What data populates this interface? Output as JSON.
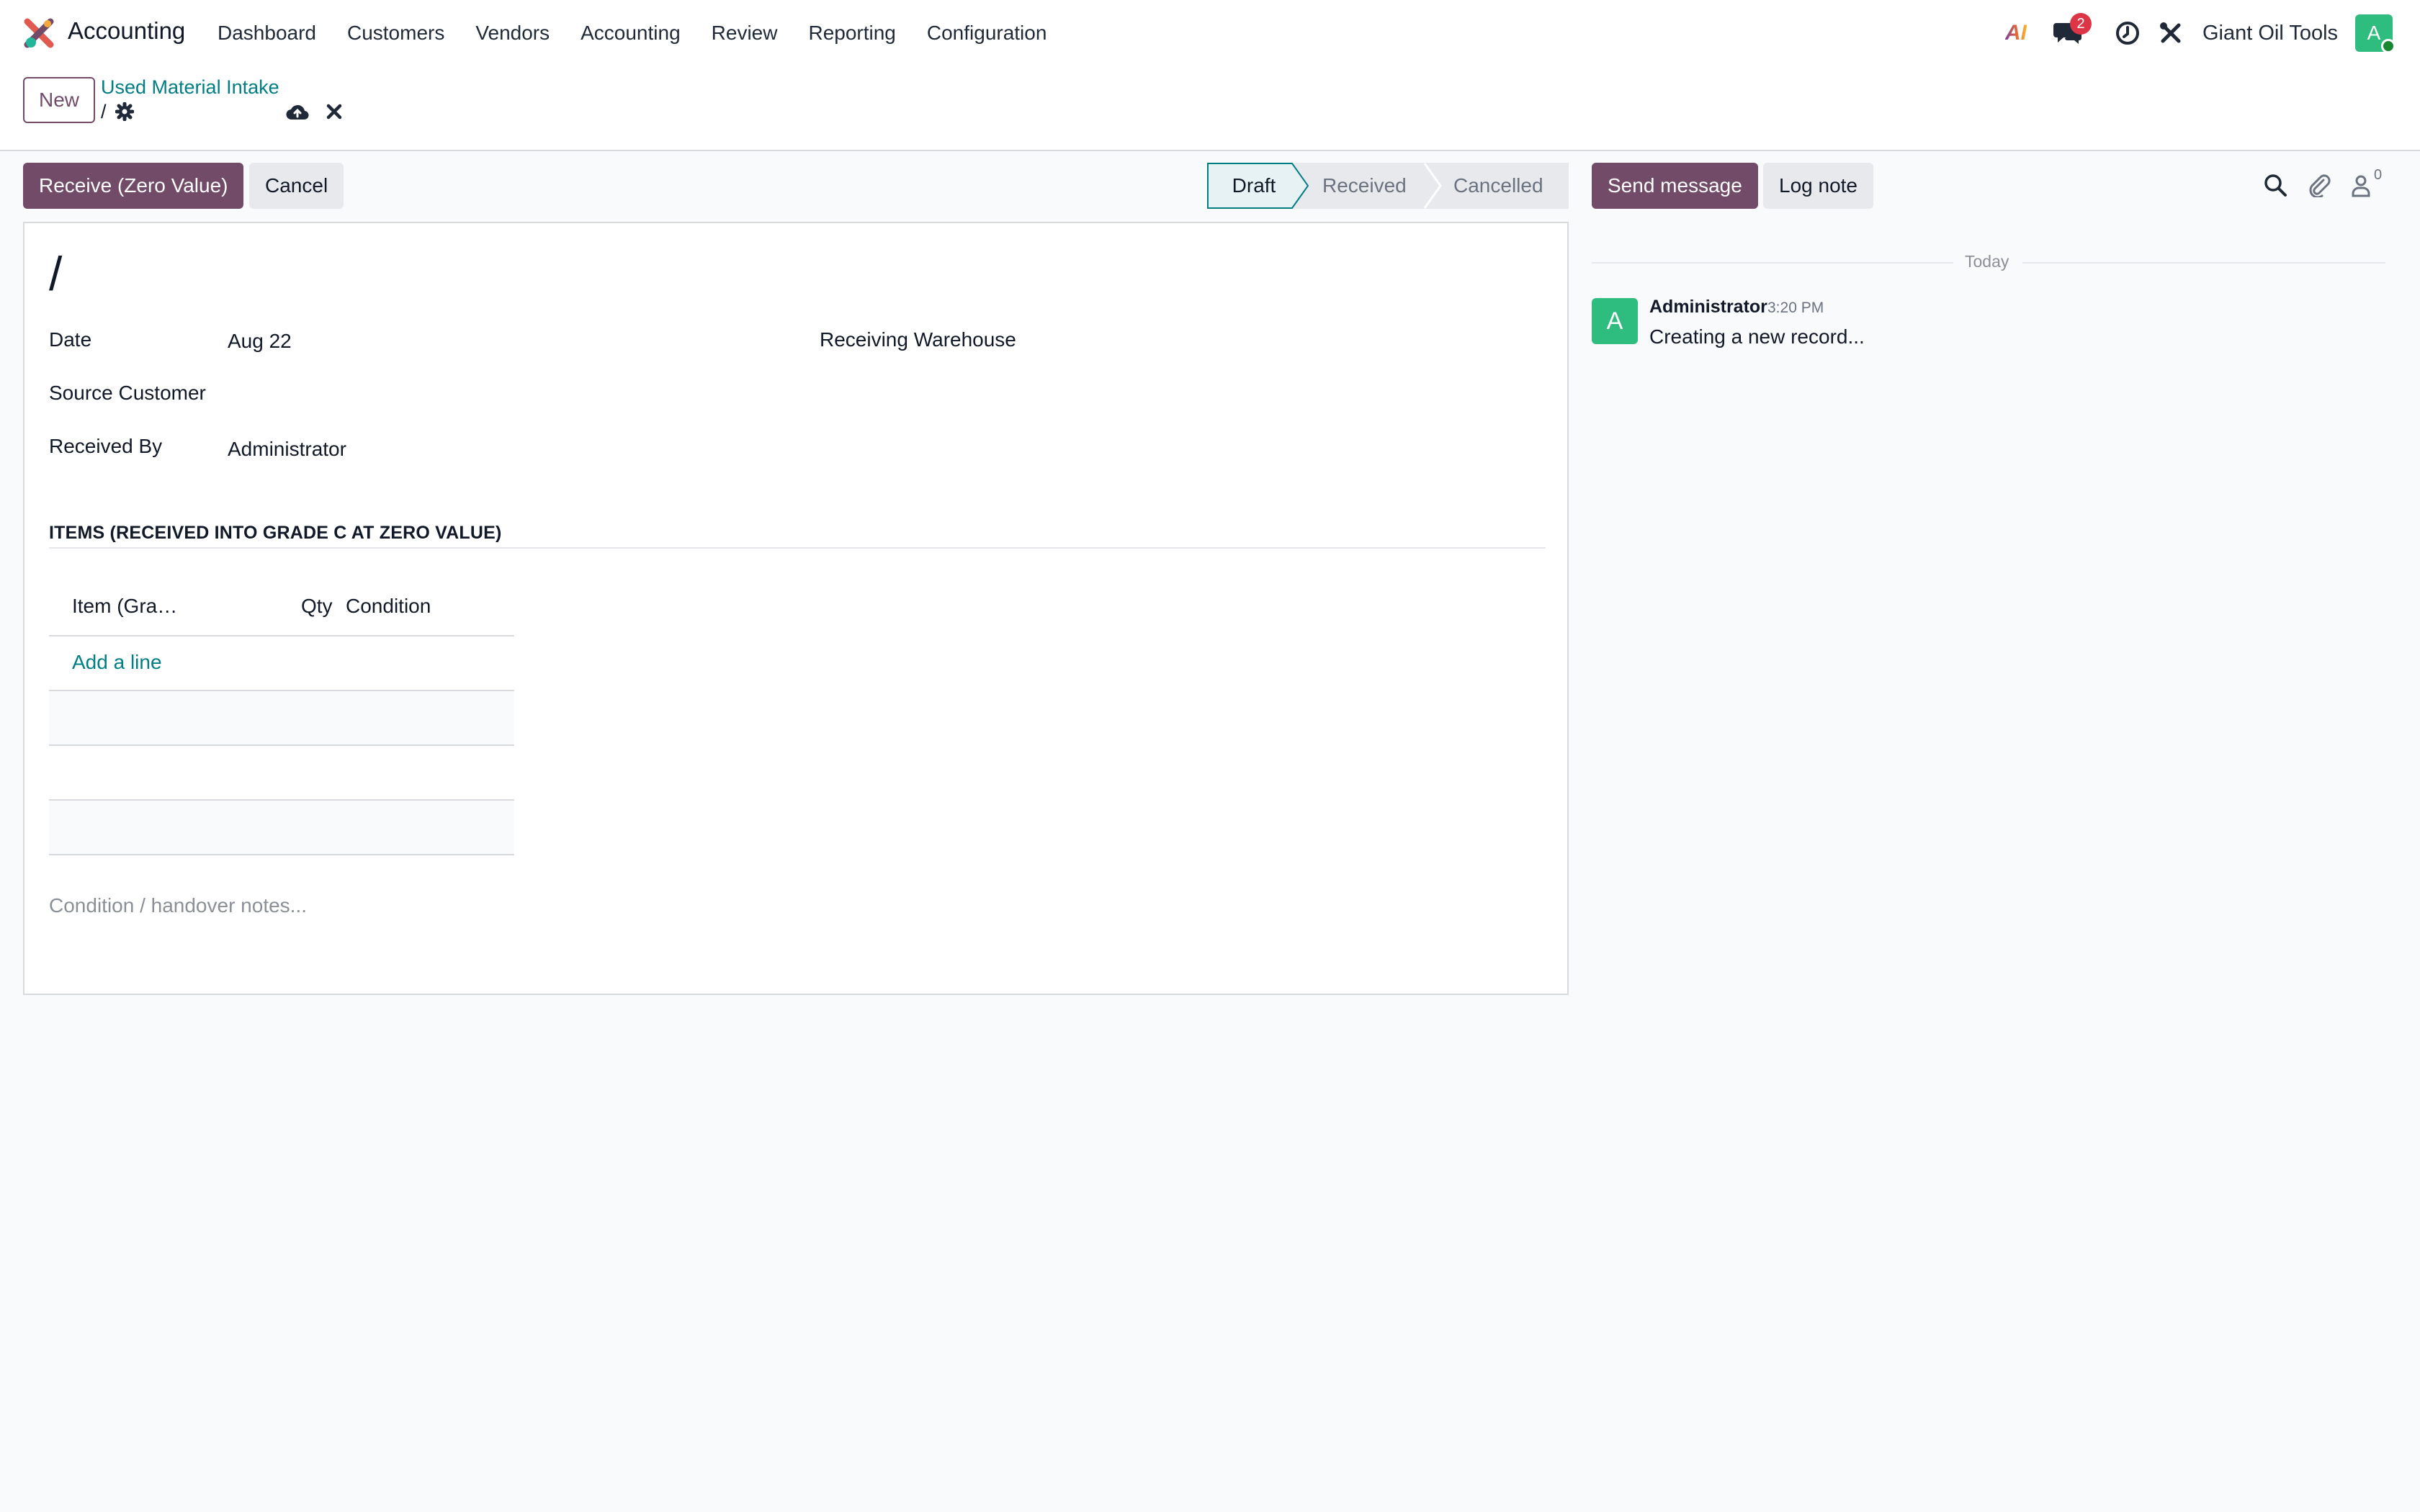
{
  "navbar": {
    "app_name": "Accounting",
    "menu": [
      "Dashboard",
      "Customers",
      "Vendors",
      "Accounting",
      "Review",
      "Reporting",
      "Configuration"
    ],
    "ai_label": "AI",
    "messages_badge": "2",
    "company": "Giant Oil Tools",
    "user_initial": "A"
  },
  "control": {
    "new_label": "New",
    "breadcrumb_parent": "Used Material Intake",
    "breadcrumb_current": "/"
  },
  "actions": {
    "receive_label": "Receive (Zero Value)",
    "cancel_label": "Cancel"
  },
  "status": {
    "stages": [
      "Draft",
      "Received",
      "Cancelled"
    ],
    "active": "Draft"
  },
  "form": {
    "record_name": "/",
    "date_label": "Date",
    "date_value": "Aug 22",
    "warehouse_label": "Receiving Warehouse",
    "source_label": "Source Customer",
    "received_by_label": "Received By",
    "received_by_value": "Administrator",
    "items_title": "ITEMS (RECEIVED INTO GRADE C AT ZERO VALUE)",
    "columns": [
      "Item (Gra…",
      "Qty",
      "Condition"
    ],
    "add_line": "Add a line",
    "notes_placeholder": "Condition / handover notes..."
  },
  "chatter": {
    "send_label": "Send message",
    "log_label": "Log note",
    "followers_count": "0",
    "today_label": "Today",
    "message": {
      "author": "Administrator",
      "initial": "A",
      "time": "3:20 PM",
      "body": "Creating a new record..."
    }
  },
  "colors": {
    "primary": "#714b67",
    "link": "#017e84",
    "avatar": "#2ebd7e",
    "badge": "#dc3545"
  }
}
